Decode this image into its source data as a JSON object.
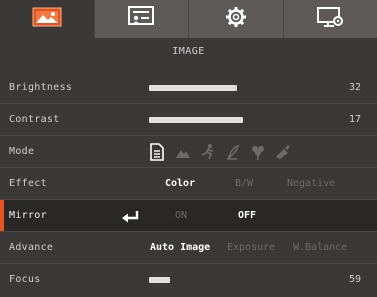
{
  "tabs": [
    {
      "icon": "image-icon",
      "active": true
    },
    {
      "icon": "presentation-icon",
      "active": false
    },
    {
      "icon": "gear-icon",
      "active": false
    },
    {
      "icon": "monitor-settings-icon",
      "active": false
    }
  ],
  "accent_color": "#e8521f",
  "section_title": "IMAGE",
  "brightness": {
    "label": "Brightness",
    "value": "32",
    "level": 0.46
  },
  "contrast": {
    "label": "Contrast",
    "value": "17",
    "level": 0.49
  },
  "mode": {
    "label": "Mode",
    "icons": [
      "document-mode-icon",
      "landscape-mode-icon",
      "sports-mode-icon",
      "sketch-mode-icon",
      "macro-mode-icon",
      "paint-mode-icon"
    ],
    "selected_icon": "document-mode-icon"
  },
  "effect": {
    "label": "Effect",
    "options": [
      "Color",
      "B/W",
      "Negative"
    ],
    "selected": "Color"
  },
  "mirror": {
    "label": "Mirror",
    "enter_icon": "enter-arrow-icon",
    "options": [
      "ON",
      "OFF"
    ],
    "selected": "OFF"
  },
  "advance": {
    "label": "Advance",
    "options": [
      "Auto Image",
      "Exposure",
      "W.Balance"
    ],
    "selected": "Auto Image"
  },
  "focus": {
    "label": "Focus",
    "value": "59",
    "level": 0.11
  }
}
